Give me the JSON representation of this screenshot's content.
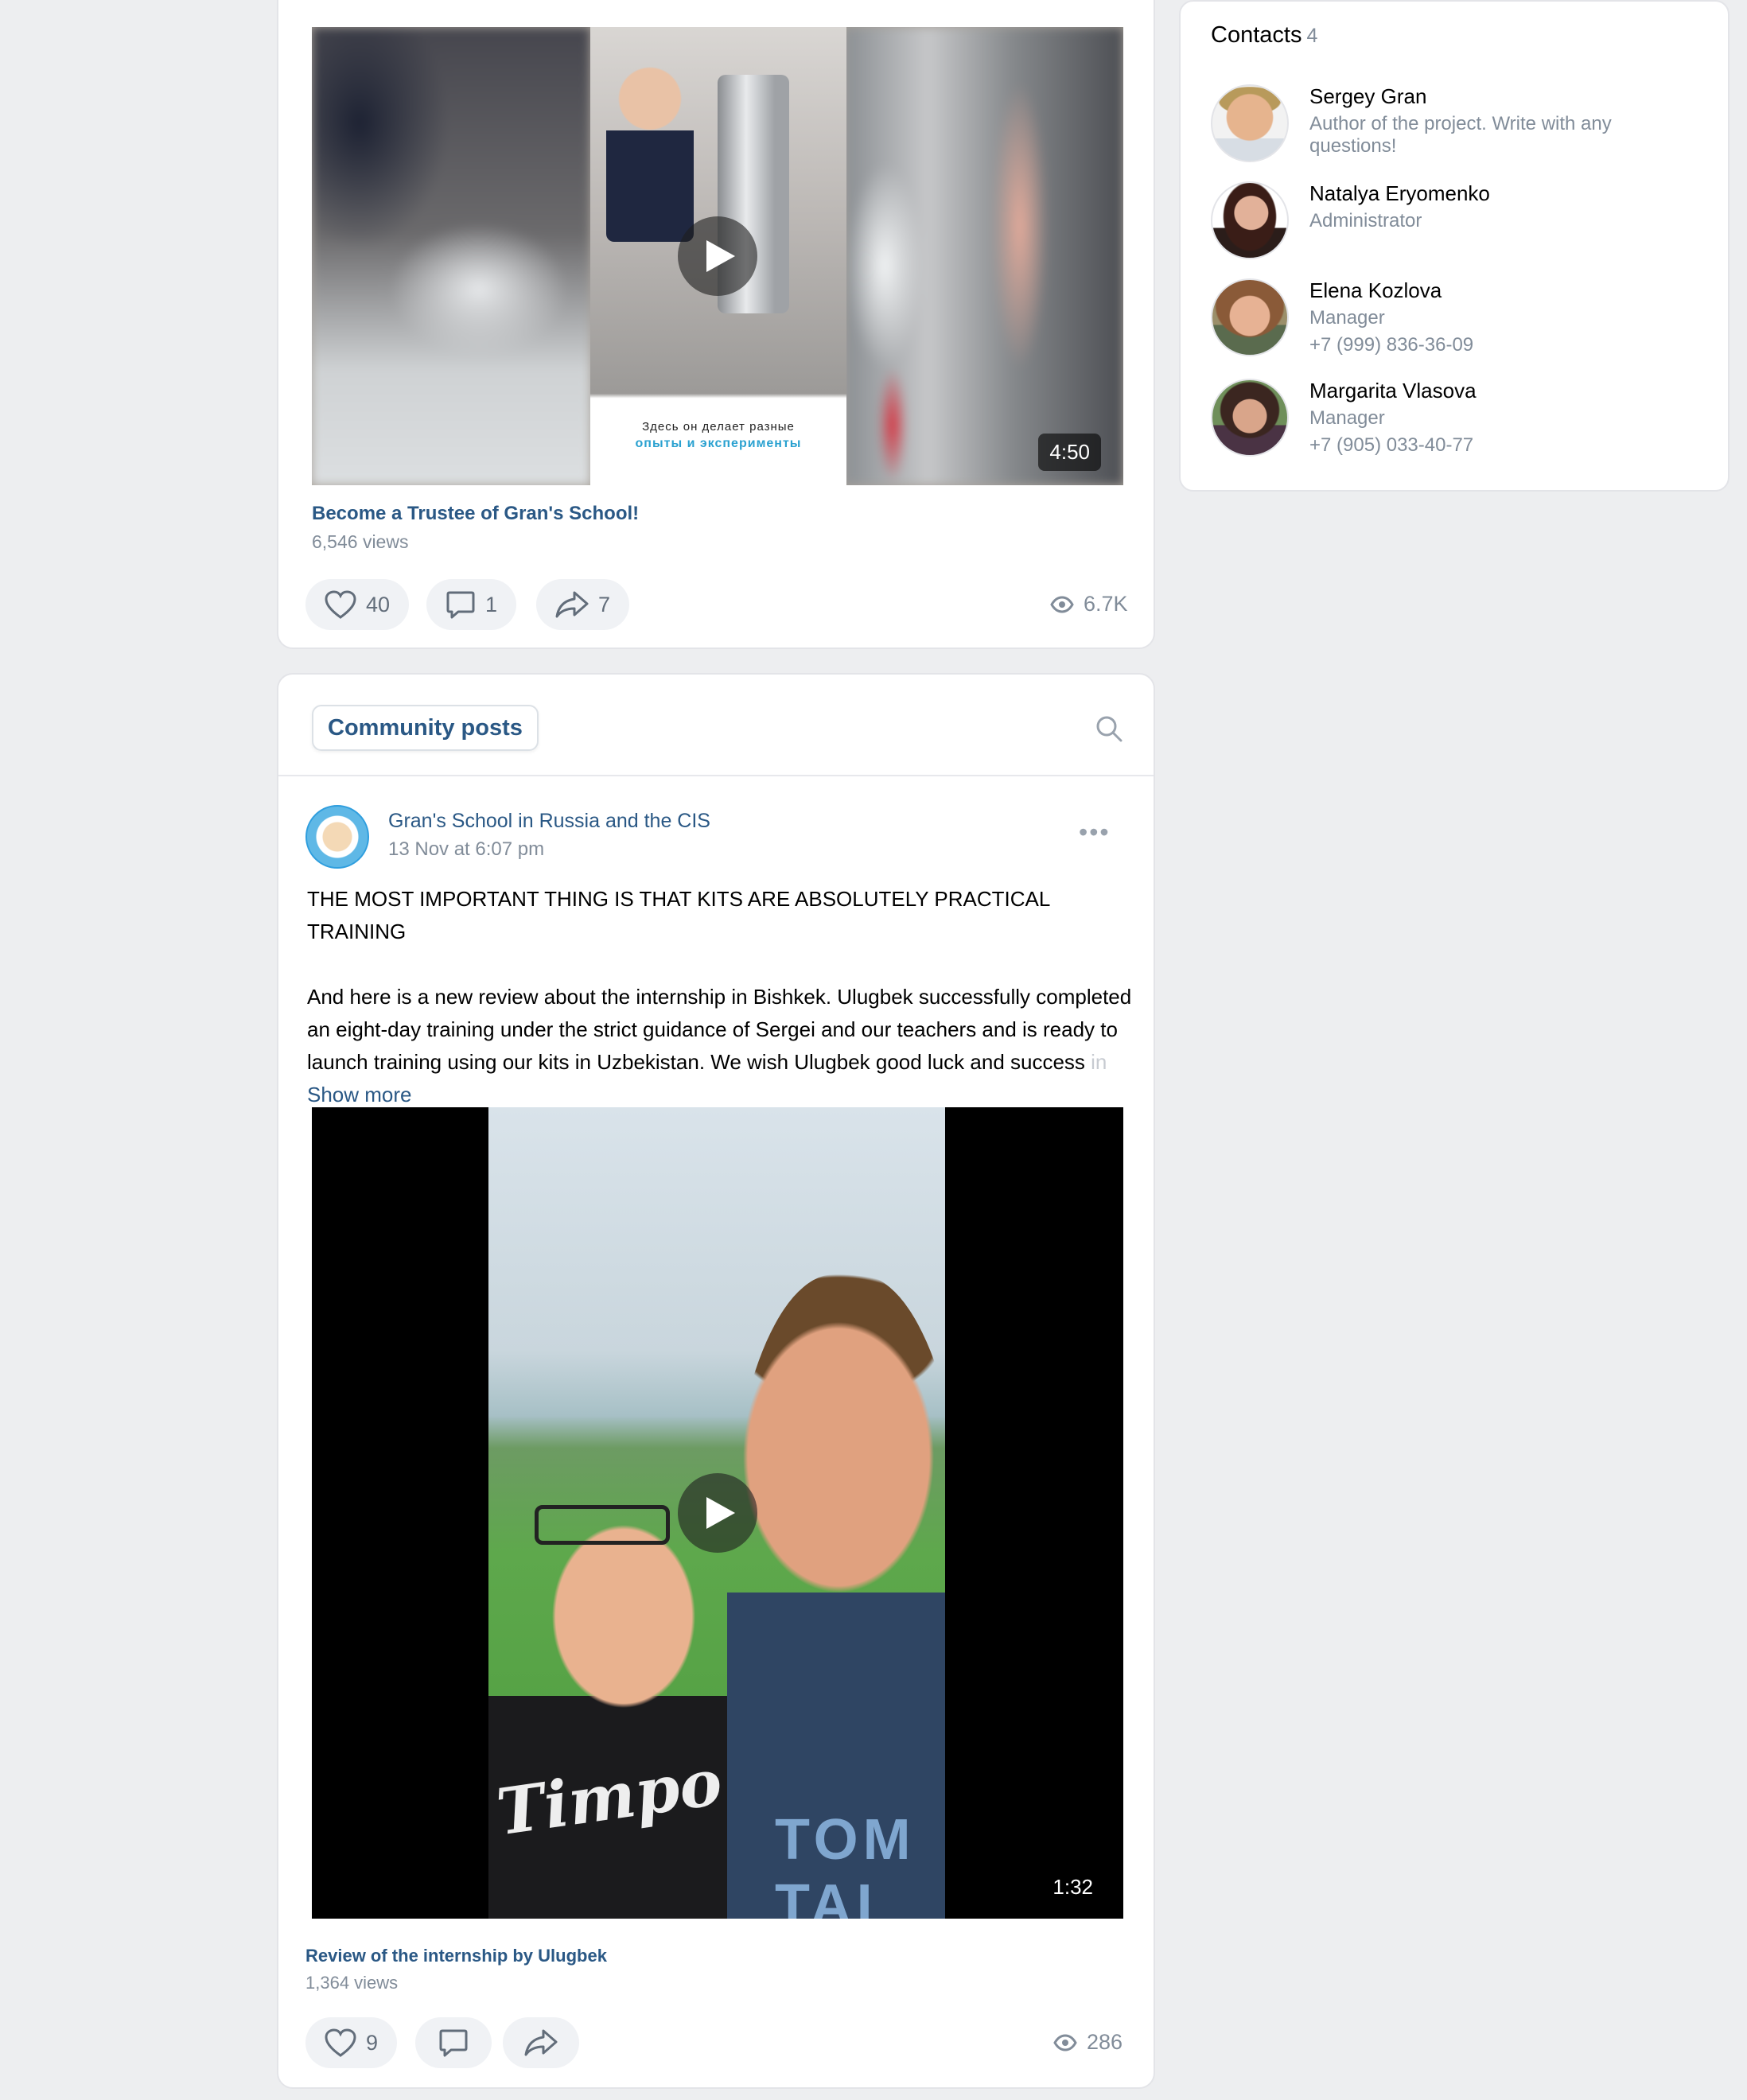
{
  "top_post": {
    "video": {
      "caption_line1": "Здесь он делает разные",
      "caption_line2": "опыты и эксперименты",
      "duration": "4:50",
      "title": "Become a Trustee of Gran's School!",
      "views": "6,546 views"
    },
    "actions": {
      "likes": "40",
      "comments": "1",
      "shares": "7",
      "views": "6.7K"
    }
  },
  "community": {
    "tab_label": "Community posts",
    "post": {
      "author": "Gran's School in Russia and the CIS",
      "date": "13 Nov at 6:07 pm",
      "headline": "THE MOST IMPORTANT THING IS THAT KITS ARE ABSOLUTELY PRACTICAL TRAINING",
      "body": "And here is a new review about the internship in Bishkek. Ulugbek successfully completed an eight-day training under the strict guidance of Sergei and our teachers and is ready to launch training using our kits in Uzbekistan. We wish Ulugbek good luck and success ",
      "body_fade": "in",
      "show_more": "Show more",
      "video": {
        "duration": "1:32",
        "shirt_text": "Timpo",
        "hoodie_text": "TOM TAI",
        "title": "Review of the internship by Ulugbek",
        "views": "1,364 views"
      },
      "actions": {
        "likes": "9",
        "views": "286"
      }
    }
  },
  "contacts": {
    "title": "Contacts",
    "count": "4",
    "items": [
      {
        "name": "Sergey Gran",
        "role": "Author of the project. Write with any questions!",
        "phone": ""
      },
      {
        "name": "Natalya Eryomenko",
        "role": "Administrator",
        "phone": ""
      },
      {
        "name": "Elena Kozlova",
        "role": "Manager",
        "phone": "+7 (999) 836-36-09"
      },
      {
        "name": "Margarita Vlasova",
        "role": "Manager",
        "phone": "+7 (905) 033-40-77"
      }
    ]
  },
  "colors": {
    "link": "#2a5885",
    "muted": "#818c99",
    "page_bg": "#edeef0",
    "pill_bg": "#f0f2f5"
  }
}
